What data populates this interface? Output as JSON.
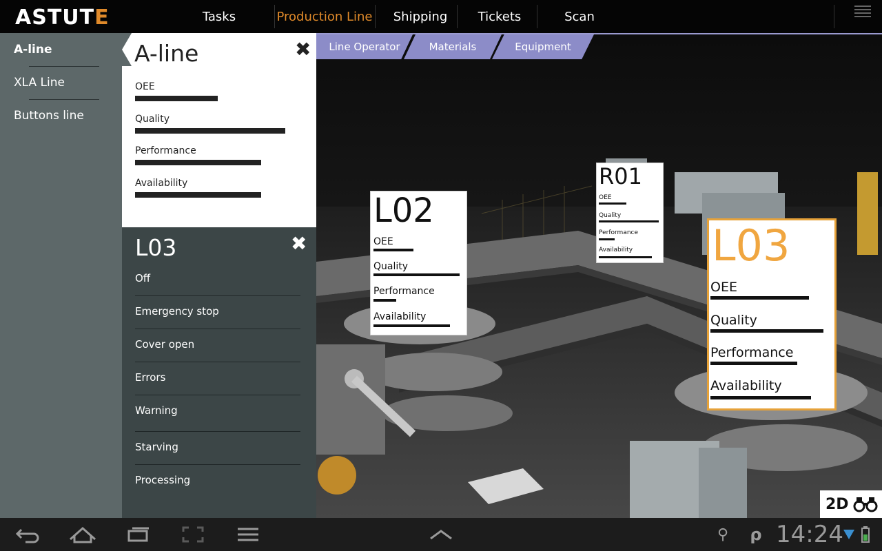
{
  "app": {
    "logo_main": "ASTUT",
    "logo_accent": "E"
  },
  "nav": {
    "items": [
      {
        "label": "Tasks",
        "active": false
      },
      {
        "label": "Production Line",
        "active": true
      },
      {
        "label": "Shipping",
        "active": false
      },
      {
        "label": "Tickets",
        "active": false
      },
      {
        "label": "Scan",
        "active": false
      }
    ]
  },
  "sidebar": {
    "items": [
      {
        "label": "A-line",
        "selected": true
      },
      {
        "label": "XLA  Line",
        "selected": false
      },
      {
        "label": "Buttons line",
        "selected": false
      }
    ]
  },
  "line_panel": {
    "title": "A-line",
    "close_icon": "close-icon",
    "metrics": [
      {
        "label": "OEE",
        "level": 0.55
      },
      {
        "label": "Quality",
        "level": 1.0
      },
      {
        "label": "Performance",
        "level": 0.84
      },
      {
        "label": "Availability",
        "level": 0.84
      }
    ]
  },
  "status_panel": {
    "title": "L03",
    "close_icon": "close-icon",
    "items": [
      "Off",
      "Emergency stop",
      "Cover open",
      "Errors",
      "Warning",
      "Starving",
      "Processing"
    ]
  },
  "scene_tabs": [
    "Line Operator",
    "Materials",
    "Equipment"
  ],
  "cards": [
    {
      "id": "L02",
      "highlight": false,
      "metrics": [
        {
          "label": "OEE",
          "level": 0.46
        },
        {
          "label": "Quality",
          "level": 1.0
        },
        {
          "label": "Performance",
          "level": 0.26
        },
        {
          "label": "Availability",
          "level": 0.89
        }
      ]
    },
    {
      "id": "R01",
      "highlight": false,
      "metrics": [
        {
          "label": "OEE",
          "level": 0.46
        },
        {
          "label": "Quality",
          "level": 1.0
        },
        {
          "label": "Performance",
          "level": 0.26
        },
        {
          "label": "Availability",
          "level": 0.89
        }
      ]
    },
    {
      "id": "L03",
      "highlight": true,
      "metrics": [
        {
          "label": "OEE",
          "level": 0.87
        },
        {
          "label": "Quality",
          "level": 1.0
        },
        {
          "label": "Performance",
          "level": 0.77
        },
        {
          "label": "Availability",
          "level": 0.89
        }
      ]
    }
  ],
  "view_toggle": {
    "label": "2D",
    "icon": "binoculars-icon"
  },
  "system_bar": {
    "time": "14:24",
    "icons": [
      "back-icon",
      "home-icon",
      "recent-apps-icon",
      "screenshot-icon",
      "menu-icon",
      "chevron-up-icon",
      "usb-icon",
      "p-icon",
      "wifi-icon",
      "battery-icon"
    ],
    "p_label": "ρ"
  },
  "colors": {
    "accent": "#e08a2a",
    "tab": "#8c8cc8",
    "sidebar": "#5d6869",
    "status_panel": "#3c4647"
  }
}
